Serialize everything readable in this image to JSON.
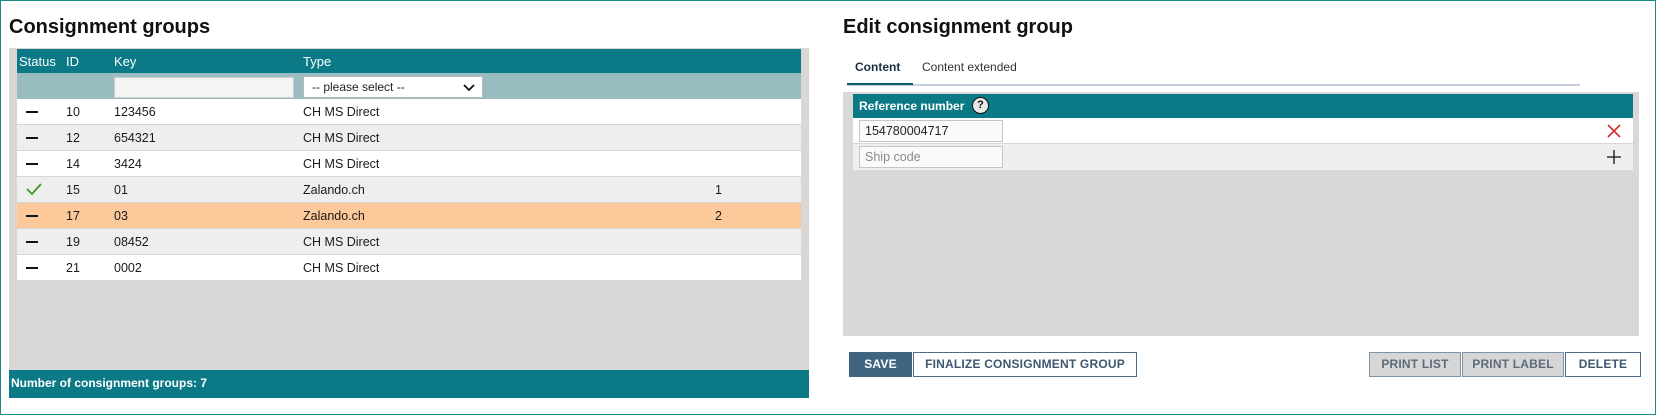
{
  "left": {
    "title": "Consignment groups",
    "columns": {
      "status": "Status",
      "id": "ID",
      "key": "Key",
      "type": "Type"
    },
    "filter": {
      "key_value": "",
      "type_value": "-- please select --"
    },
    "rows": [
      {
        "status": "dash",
        "id": "10",
        "key": "123456",
        "type": "CH MS Direct",
        "count": ""
      },
      {
        "status": "dash",
        "id": "12",
        "key": "654321",
        "type": "CH MS Direct",
        "count": ""
      },
      {
        "status": "dash",
        "id": "14",
        "key": "3424",
        "type": "CH MS Direct",
        "count": ""
      },
      {
        "status": "check",
        "id": "15",
        "key": "01",
        "type": "Zalando.ch",
        "count": "1"
      },
      {
        "status": "dash",
        "id": "17",
        "key": "03",
        "type": "Zalando.ch",
        "count": "2",
        "selected": true
      },
      {
        "status": "dash",
        "id": "19",
        "key": "08452",
        "type": "CH MS Direct",
        "count": ""
      },
      {
        "status": "dash",
        "id": "21",
        "key": "0002",
        "type": "CH MS Direct",
        "count": ""
      }
    ],
    "footer": "Number of consignment groups: 7"
  },
  "right": {
    "title": "Edit consignment group",
    "tabs": [
      {
        "label": "Content",
        "active": true
      },
      {
        "label": "Content extended",
        "active": false
      }
    ],
    "reference": {
      "header": "Reference number",
      "help_icon": "question-circle-icon",
      "value": "154780004717",
      "placeholder": "Ship code"
    },
    "buttons": {
      "save": "SAVE",
      "finalize": "FINALIZE CONSIGNMENT GROUP",
      "print_list": "PRINT LIST",
      "print_label": "PRINT LABEL",
      "delete": "DELETE"
    }
  },
  "colors": {
    "header_teal": "#0b7a86",
    "selected_row": "#fbc99a",
    "panel_gray": "#d9d8d6",
    "save_button": "#3f6581",
    "check_green": "#3d9a2b",
    "remove_red": "#d62b2b"
  }
}
